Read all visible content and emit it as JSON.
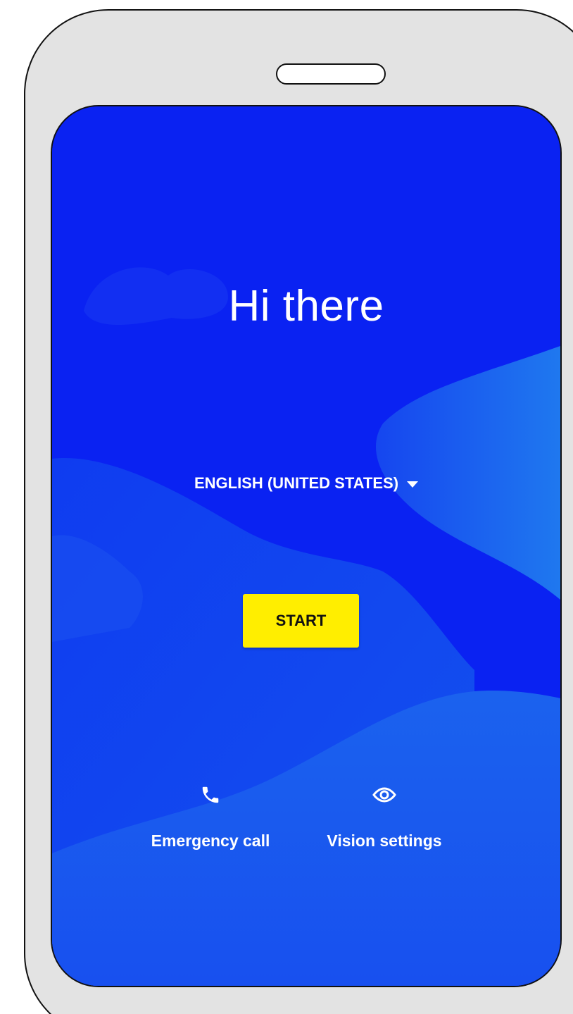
{
  "welcome": {
    "title": "Hi there",
    "language": "ENGLISH (UNITED STATES)",
    "start_label": "START"
  },
  "footer": {
    "emergency_label": "Emergency call",
    "emergency_icon": "phone-icon",
    "vision_label": "Vision settings",
    "vision_icon": "eye-icon"
  },
  "colors": {
    "screen_background": "#0a22f2",
    "wave_light": "#1a6cf0",
    "start_button": "#ffee00",
    "text": "#ffffff"
  }
}
